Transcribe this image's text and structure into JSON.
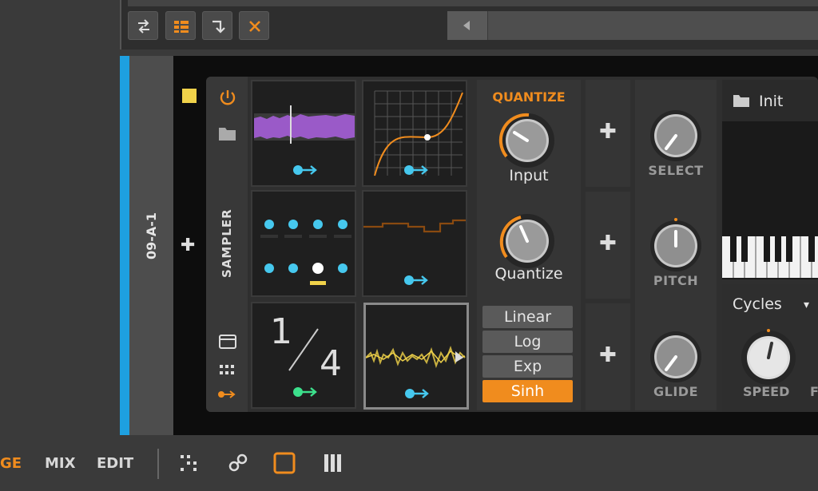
{
  "colors": {
    "accent": "#f08c1e",
    "track": "#1ea0e0",
    "mod": "#46c8ee",
    "indicator": "#f0d24a",
    "green": "#3ce08c",
    "purple": "#9a5ac8"
  },
  "toolbar": {
    "buttons": [
      {
        "icon": "swap-arrows-icon"
      },
      {
        "icon": "grid-list-icon"
      },
      {
        "icon": "arrow-down-right-icon"
      },
      {
        "icon": "close-x-icon"
      }
    ],
    "scroll_icon": "left-triangle-icon"
  },
  "track": {
    "name": "09-A-1"
  },
  "device": {
    "name": "SAMPLER",
    "sidebar_icons": [
      "power-icon",
      "folder-icon",
      "window-icon",
      "grid-icon",
      "modulator-icon"
    ],
    "cells": [
      {
        "id": "sampler-wave"
      },
      {
        "id": "curve"
      },
      {
        "id": "step-dots"
      },
      {
        "id": "steps"
      },
      {
        "id": "fraction",
        "numerator": "1",
        "denominator": "4"
      },
      {
        "id": "audio-wave"
      }
    ],
    "quantize": {
      "title": "QUANTIZE",
      "knobs": [
        {
          "label": "Input"
        },
        {
          "label": "Quantize"
        }
      ],
      "modes": [
        "Linear",
        "Log",
        "Exp",
        "Sinh"
      ],
      "active_mode": "Sinh"
    },
    "macros": [
      {
        "label": "SELECT"
      },
      {
        "label": "PITCH"
      },
      {
        "label": "GLIDE"
      }
    ],
    "preset": {
      "name": "Init"
    },
    "lfo": {
      "shape": "Cycles",
      "speed_label": "SPEED",
      "partial_label": "F"
    }
  },
  "bottom_nav": {
    "items": [
      "GE",
      "MIX",
      "EDIT"
    ],
    "active": "GE",
    "icons": [
      "dots-icon",
      "link-icon",
      "square-icon",
      "bars-icon"
    ]
  }
}
